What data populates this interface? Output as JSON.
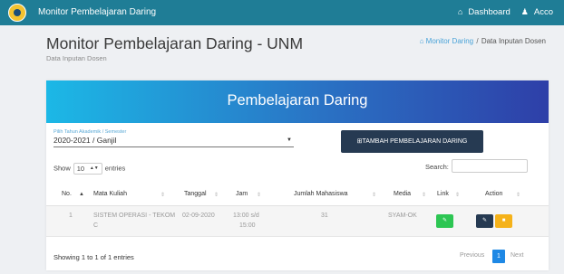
{
  "navbar": {
    "brand": "Monitor Pembelajaran Daring",
    "dashboard_label": "Dashboard",
    "account_label": "Acco"
  },
  "page": {
    "title": "Monitor Pembelajaran Daring - UNM",
    "subtitle": "Data Inputan Dosen"
  },
  "breadcrumb": {
    "home": "Monitor Daring",
    "separator": "/",
    "current": "Data Inputan Dosen"
  },
  "card": {
    "header": "Pembelajaran Daring",
    "semester_label": "Pilih Tahun Akademik / Semester",
    "semester_value": "2020-2021 / Ganjil",
    "add_button": "TAMBAH PEMBELAJARAN DARING",
    "show_label": "Show",
    "entries_value": "10",
    "entries_label": "entries",
    "search_label": "Search:"
  },
  "table": {
    "columns": [
      "No.",
      "Mata Kuliah",
      "Tanggal",
      "Jam",
      "Jumlah Mahasiswa",
      "Media",
      "Link",
      "Action"
    ],
    "rows": [
      {
        "no": "1",
        "mata_kuliah_line1": "SISTEM OPERASI - TEKOM",
        "mata_kuliah_line2": "C",
        "tanggal": "02-09-2020",
        "jam_line1": "13:00 s/d",
        "jam_line2": "15:00",
        "jumlah": "31",
        "media": "SYAM-OK"
      }
    ]
  },
  "footer": {
    "info": "Showing 1 to 1 of 1 entries",
    "previous": "Previous",
    "page": "1",
    "next": "Next"
  },
  "colors": {
    "navbar": "#1f7d96",
    "header_gradient_start": "#1cb8e6",
    "header_gradient_end": "#2e3fa8",
    "add_button": "#263a52",
    "link_button": "#2dc653",
    "delete_button": "#f5b21a",
    "active_page": "#1e88e5"
  },
  "icons": {
    "logo": "university-seal-icon",
    "dashboard": "home-icon",
    "account": "user-icon",
    "breadcrumb_home": "home-icon",
    "add": "plus-square-icon",
    "link": "link-icon",
    "edit": "edit-icon",
    "delete": "trash-icon"
  }
}
